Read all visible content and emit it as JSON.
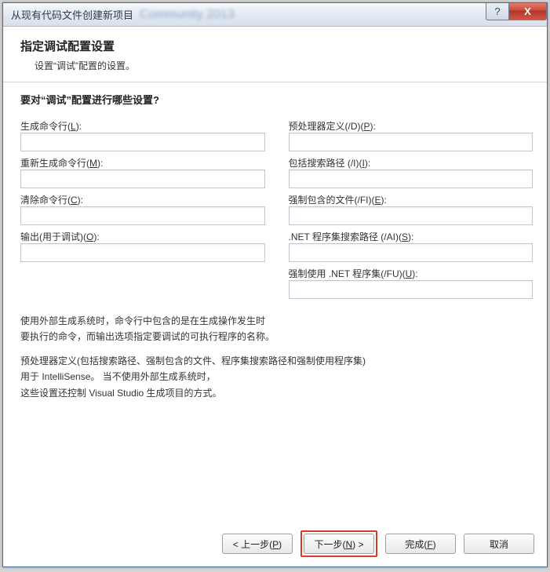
{
  "titlebar": {
    "title": "从现有代码文件创建新项目",
    "blur_text": "Community 2013",
    "help": "?",
    "close": "X"
  },
  "header": {
    "heading": "指定调试配置设置",
    "sub": "设置“调试”配置的设置。"
  },
  "section_question": "要对“调试”配置进行哪些设置?",
  "fields": {
    "build_cmd": {
      "label_pre": "生成命令行(",
      "label_key": "L",
      "label_post": "):",
      "value": ""
    },
    "rebuild_cmd": {
      "label_pre": "重新生成命令行(",
      "label_key": "M",
      "label_post": "):",
      "value": ""
    },
    "clean_cmd": {
      "label_pre": "清除命令行(",
      "label_key": "C",
      "label_post": "):",
      "value": ""
    },
    "output": {
      "label_pre": "输出(用于调试)(",
      "label_key": "O",
      "label_post": "):",
      "value": ""
    },
    "preproc": {
      "label_pre": "预处理器定义(/D)(",
      "label_key": "P",
      "label_post": "):",
      "value": ""
    },
    "include": {
      "label_pre": "包括搜索路径 (/I)(",
      "label_key": "I",
      "label_post": "):",
      "value": ""
    },
    "forced_inc": {
      "label_pre": "强制包含的文件(/FI)(",
      "label_key": "E",
      "label_post": "):",
      "value": ""
    },
    "net_asm": {
      "label_pre": ".NET 程序集搜索路径 (/AI)(",
      "label_key": "S",
      "label_post": "):",
      "value": ""
    },
    "forced_net": {
      "label_pre": "强制使用 .NET 程序集(/FU)(",
      "label_key": "U",
      "label_post": "):",
      "value": ""
    }
  },
  "description": {
    "p1a": "使用外部生成系统时，命令行中包含的是在生成操作发生时",
    "p1b": "要执行的命令，而输出选项指定要调试的可执行程序的名称。",
    "p2a": "预处理器定义(包括搜索路径、强制包含的文件、程序集搜索路径和强制使用程序集)",
    "p2b": "用于 IntelliSense。 当不使用外部生成系统时，",
    "p2c": "这些设置还控制 Visual Studio 生成项目的方式。"
  },
  "buttons": {
    "back": {
      "pre": "< 上一步(",
      "key": "P",
      "post": ")"
    },
    "next": {
      "pre": "下一步(",
      "key": "N",
      "post": ") >"
    },
    "finish": {
      "pre": "完成(",
      "key": "F",
      "post": ")"
    },
    "cancel": {
      "text": "取消"
    }
  }
}
